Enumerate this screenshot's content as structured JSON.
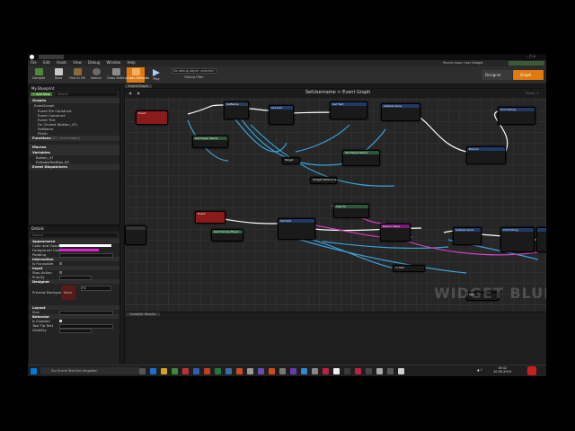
{
  "window": {
    "title": ""
  },
  "menu": [
    "File",
    "Edit",
    "Asset",
    "View",
    "Debug",
    "Window",
    "Help"
  ],
  "parent_class": "Parent class: User Widget",
  "toolbar": {
    "buttons": [
      "Compile",
      "Save",
      "Find in CB",
      "Search",
      "Class Settings",
      "Class Defaults",
      "Play"
    ],
    "debug_select": "No debug object selected",
    "debug_filter": "Debug Filter"
  },
  "mode_tabs": {
    "designer": "Designer",
    "graph": "Graph"
  },
  "my_blueprint": {
    "tab": "My Blueprint",
    "add_new": "+ Add New",
    "search_placeholder": "Search",
    "graphs_header": "Graphs",
    "event_graph": "EventGraph",
    "graph_items": [
      "Event Pre Construct",
      "Event Construct",
      "Event Tick",
      "On Clicked (Button_47)",
      "SetName",
      "Finish"
    ],
    "functions_header": "Functions",
    "functions_note": "(21 Overridable)",
    "macros_header": "Macros",
    "variables_header": "Variables",
    "variables": [
      "Button_47",
      "EditableTextBox_83"
    ],
    "dispatchers_header": "Event Dispatchers"
  },
  "details": {
    "tab": "Details",
    "search_placeholder": "Search",
    "appearance": "Appearance",
    "props_appearance": [
      "Color and Opacity",
      "Foreground Color",
      "Padding"
    ],
    "interaction": "Interaction",
    "props_interaction": [
      "Is Focusable"
    ],
    "input": "Input",
    "props_input": [
      "Stop Action",
      "Priority"
    ],
    "designer": "Designer",
    "props_designer": [
      "Preview Background"
    ],
    "layout": "Layout",
    "props_layout": [
      "Size"
    ],
    "behavior": "Behavior",
    "props_behavior": [
      "Is Enabled",
      "Tool Tip Text",
      "Visibility"
    ],
    "none_label": "None",
    "fill_label": "Fill"
  },
  "graph": {
    "tab": "Event Graph",
    "breadcrumb_a": "SetUsername",
    "breadcrumb_b": "Event Graph",
    "zoom": "Zoom -1",
    "watermark": "WIDGET BLUEPRINT",
    "node_labels": [
      "Event",
      "SetName",
      "Set Text",
      "Get Text",
      "SetUsername",
      "Return Value",
      "Set Player Name",
      "Get Player Name",
      "Branch",
      "Print String",
      "Cast To",
      "Widget Reference",
      "Target",
      "In Text",
      "Get Owning Player",
      "Self"
    ]
  },
  "compiler": {
    "tab": "Compiler Results"
  },
  "taskbar": {
    "search_placeholder": "Zur Suche Text hier eingeben",
    "time": "19:42",
    "date": "10.05.2019"
  },
  "colors": {
    "accent_orange": "#e07a10",
    "exec_white": "#ffffff",
    "wire_blue": "#3aa0d8",
    "wire_pink": "#d040c0",
    "node_red": "#8b1a1a",
    "node_green": "#2a5a3a",
    "node_blue": "#1f3a66"
  }
}
